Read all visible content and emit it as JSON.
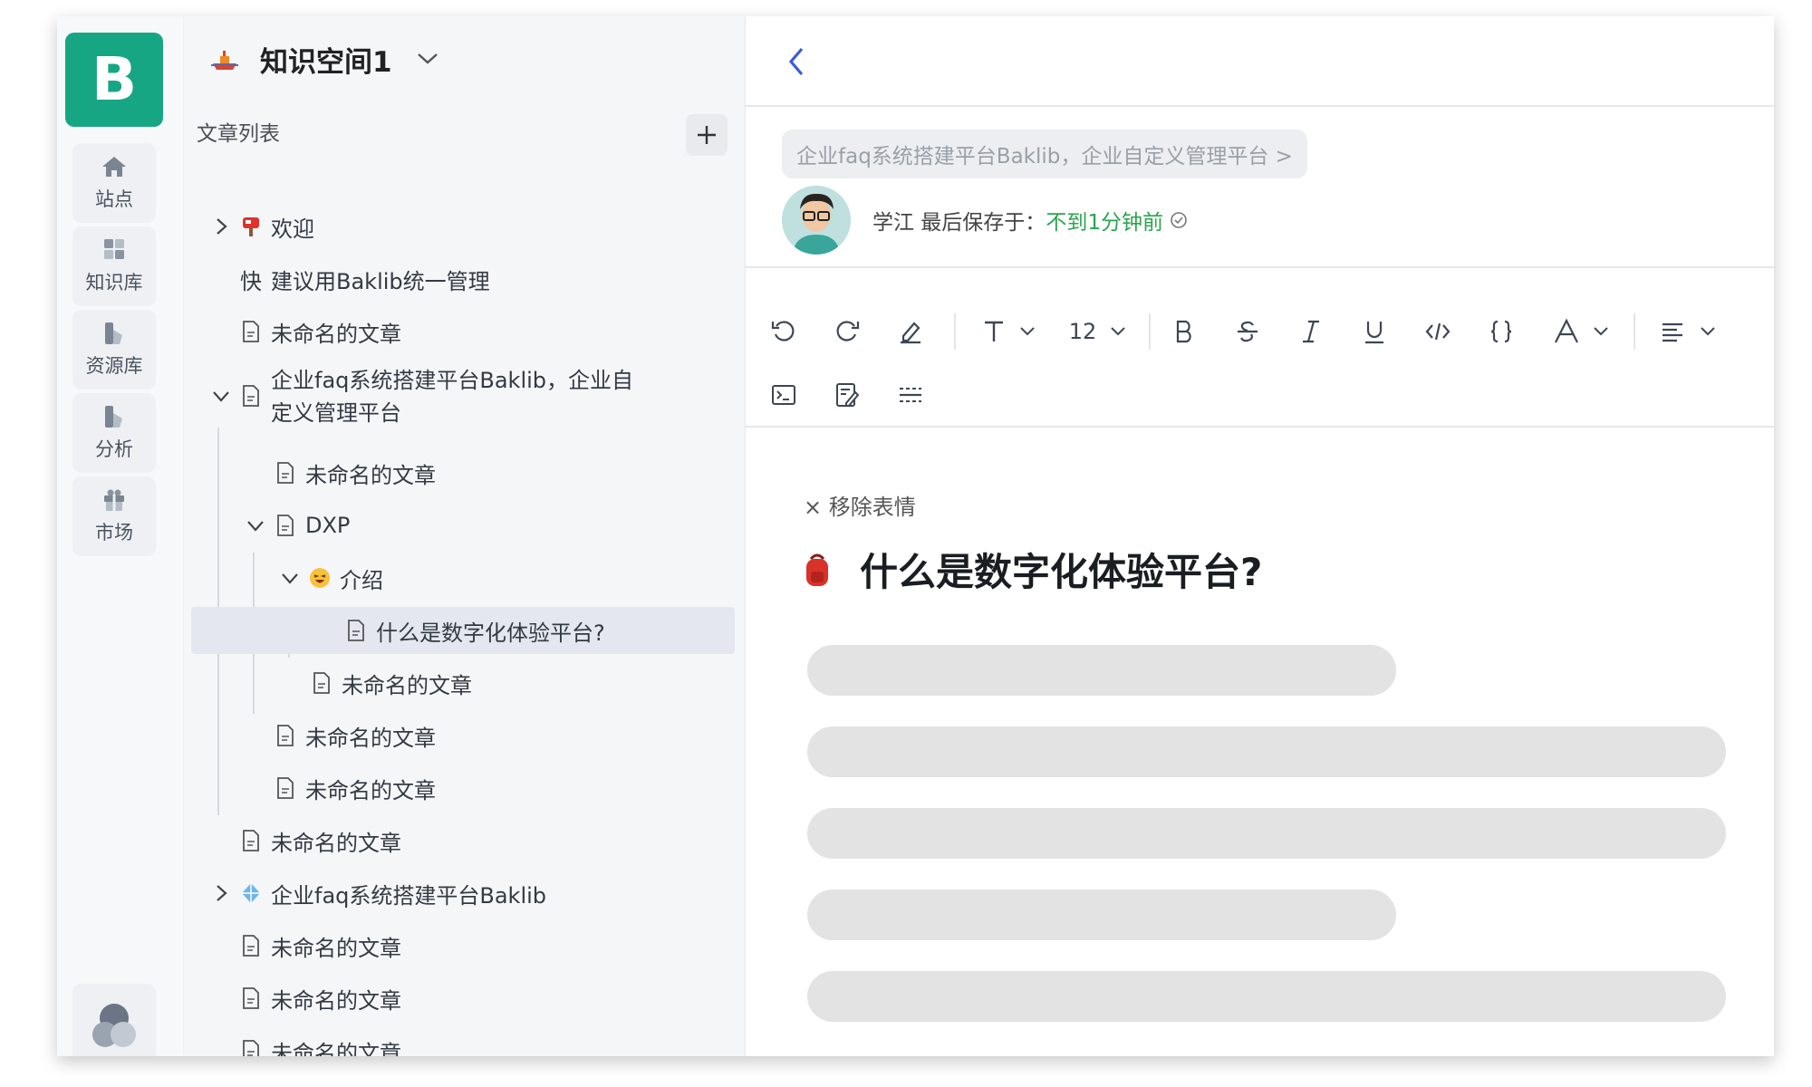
{
  "rail": {
    "logo": "B",
    "items": [
      {
        "label": "站点",
        "icon": "home-icon"
      },
      {
        "label": "知识库",
        "icon": "grid-icon"
      },
      {
        "label": "资源库",
        "icon": "resource-icon"
      },
      {
        "label": "分析",
        "icon": "analytics-icon"
      },
      {
        "label": "市场",
        "icon": "gift-icon"
      }
    ]
  },
  "space": {
    "title": "知识空间1"
  },
  "tree": {
    "header": "文章列表",
    "items": [
      {
        "label": "欢迎"
      },
      {
        "label": "建议用Baklib统一管理",
        "prefix": "快"
      },
      {
        "label": "未命名的文章"
      },
      {
        "label": "企业faq系统搭建平台Baklib，企业自",
        "label2": "定义管理平台"
      },
      {
        "label": "未命名的文章"
      },
      {
        "label": "DXP"
      },
      {
        "label": "介绍"
      },
      {
        "label": "什么是数字化体验平台?"
      },
      {
        "label": "未命名的文章"
      },
      {
        "label": "未命名的文章"
      },
      {
        "label": "未命名的文章"
      },
      {
        "label": "未命名的文章"
      },
      {
        "label": "企业faq系统搭建平台Baklib"
      },
      {
        "label": "未命名的文章"
      },
      {
        "label": "未命名的文章"
      },
      {
        "label": "未命名的文章"
      }
    ]
  },
  "editor": {
    "breadcrumb": "企业faq系统搭建平台Baklib，企业自定义管理平台 >",
    "author": "学江 最后保存于：",
    "saved": "不到1分钟前",
    "font_size": "12",
    "remove_emoji": "× 移除表情",
    "title": "什么是数字化体验平台?"
  },
  "colors": {
    "brand": "#17a683",
    "accent": "#3b5bdb",
    "saved": "#2aa44f",
    "selected_row": "#e4e7ef"
  }
}
